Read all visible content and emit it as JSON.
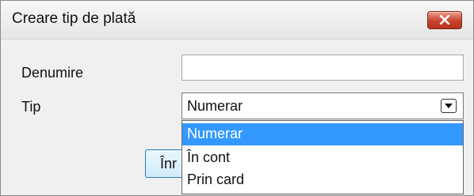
{
  "window": {
    "title": "Creare tip de plată",
    "close_icon": "close-icon"
  },
  "form": {
    "name_label": "Denumire",
    "name_value": "",
    "type_label": "Tip",
    "type_selected": "Numerar",
    "ok_button_label": "Înr"
  },
  "dropdown": {
    "options": [
      "Numerar",
      "În cont",
      "Prin card"
    ],
    "selected_index": 0
  },
  "colors": {
    "selection": "#3399ff",
    "close_button": "#c8442d"
  }
}
